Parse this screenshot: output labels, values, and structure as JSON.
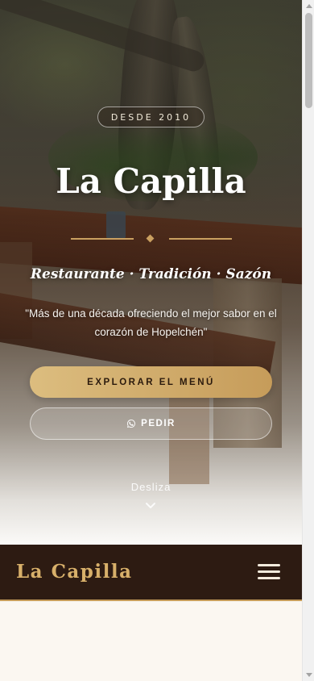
{
  "hero": {
    "badge": "DESDE 2010",
    "title": "La Capilla",
    "tagline": "Restaurante · Tradición · Sazón",
    "quote": "\"Más de una década ofreciendo el mejor sabor en el corazón de Hopelchén\"",
    "primary_button": "EXPLORAR EL MENÚ",
    "secondary_button": "PEDIR",
    "secondary_button_icon": "whatsapp-icon",
    "scroll_hint": "Desliza",
    "scroll_icon": "chevron-down-icon"
  },
  "navbar": {
    "brand": "La Capilla",
    "menu_icon": "hamburger-menu-icon"
  },
  "colors": {
    "accent_gold": "#c69c5a",
    "navbar_bg": "#2d1b12",
    "page_bg": "#fbf7f1"
  }
}
